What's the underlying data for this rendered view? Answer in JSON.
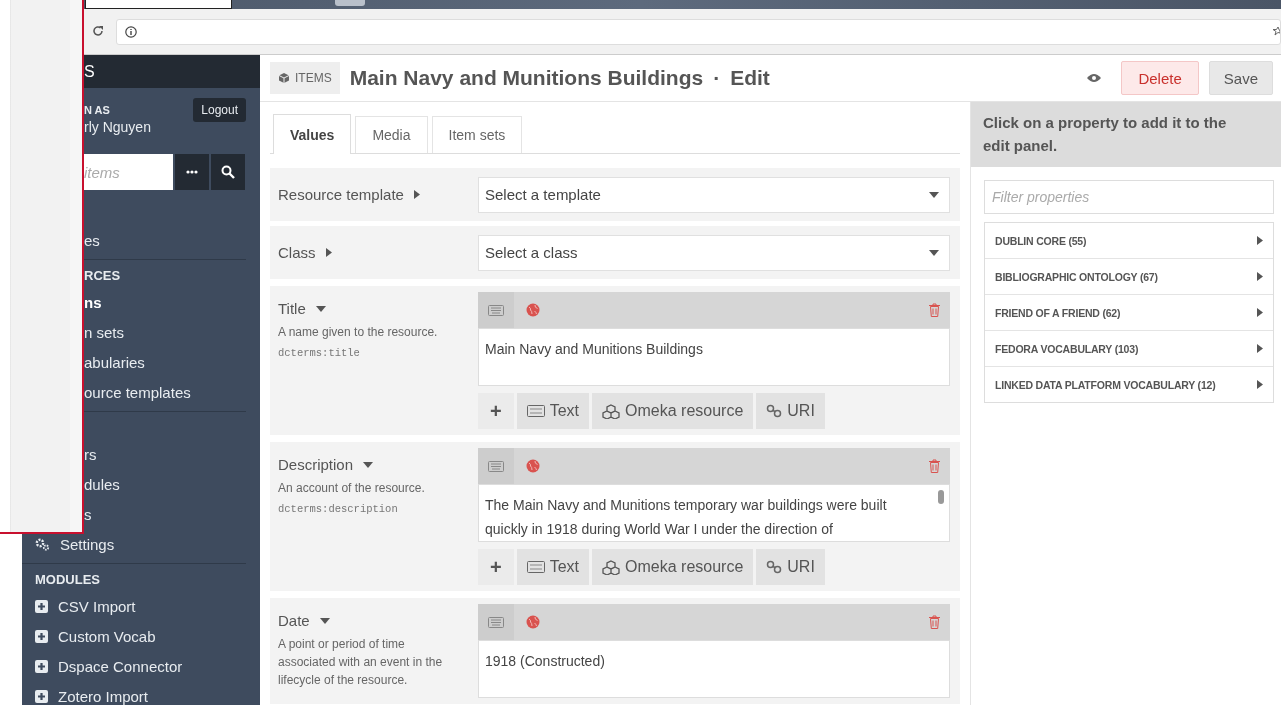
{
  "sidebar": {
    "brand": "S",
    "user_label": "N AS",
    "user_name": "rly Nguyen",
    "logout": "Logout",
    "search": {
      "placeholder": "items"
    },
    "sections": [
      {
        "items": [
          {
            "label": "es",
            "kind": "clipped",
            "selected": false
          }
        ]
      },
      {
        "heading": {
          "label": "RCES",
          "kind": "clipped"
        },
        "items": [
          {
            "label": "ns",
            "kind": "clipped",
            "selected": true
          },
          {
            "label": "n sets",
            "kind": "clipped",
            "selected": false
          },
          {
            "label": "abularies",
            "kind": "clipped",
            "selected": false
          },
          {
            "label": "ource templates",
            "kind": "clipped",
            "selected": false
          }
        ]
      },
      {
        "items": [
          {
            "label": "rs",
            "kind": "clipped",
            "selected": false
          },
          {
            "label": "dules",
            "kind": "clipped",
            "selected": false
          },
          {
            "label": "s",
            "kind": "clipped",
            "selected": false
          },
          {
            "label": "Settings",
            "kind": "settings",
            "selected": false
          }
        ]
      },
      {
        "heading": {
          "label": "MODULES",
          "kind": "plain"
        },
        "items": [
          {
            "label": "CSV Import",
            "kind": "module",
            "selected": false
          },
          {
            "label": "Custom Vocab",
            "kind": "module",
            "selected": false
          },
          {
            "label": "Dspace Connector",
            "kind": "module",
            "selected": false
          },
          {
            "label": "Zotero Import",
            "kind": "module",
            "selected": false
          }
        ]
      }
    ]
  },
  "header": {
    "badge": "ITEMS",
    "title": "Main Navy and Munitions Buildings",
    "separator": "·",
    "mode": "Edit",
    "delete": "Delete",
    "save": "Save"
  },
  "tabs": [
    {
      "label": "Values",
      "selected": true
    },
    {
      "label": "Media",
      "selected": false
    },
    {
      "label": "Item sets",
      "selected": false
    }
  ],
  "selects": [
    {
      "label": "Resource template",
      "value": "Select a template"
    },
    {
      "label": "Class",
      "value": "Select a class"
    }
  ],
  "properties": [
    {
      "label": "Title",
      "description": "A name given to the resource.",
      "term": "dcterms:title",
      "value": "Main Navy and Munitions Buildings",
      "scrollbar": false,
      "buttons": [
        {
          "kind": "add",
          "label": "+"
        },
        {
          "kind": "text",
          "label": "Text"
        },
        {
          "kind": "resource",
          "label": "Omeka resource"
        },
        {
          "kind": "uri",
          "label": "URI"
        }
      ]
    },
    {
      "label": "Description",
      "description": "An account of the resource.",
      "term": "dcterms:description",
      "value": "The Main Navy and Munitions temporary war buildings were built quickly in 1918 during World War I under the direction of",
      "scrollbar": true,
      "buttons": [
        {
          "kind": "add",
          "label": "+"
        },
        {
          "kind": "text",
          "label": "Text"
        },
        {
          "kind": "resource",
          "label": "Omeka resource"
        },
        {
          "kind": "uri",
          "label": "URI"
        }
      ]
    },
    {
      "label": "Date",
      "description": "A point or period of time associated with an event in the lifecycle of the resource.",
      "value": "1918 (Constructed)",
      "scrollbar": false
    }
  ],
  "property_panel": {
    "prompt": "Click on a property to add it to the edit panel.",
    "filter": {
      "placeholder": "Filter properties"
    },
    "vocabularies": [
      {
        "label": "DUBLIN CORE (55)",
        "expanded": false
      },
      {
        "label": "BIBLIOGRAPHIC ONTOLOGY (67)",
        "expanded": false
      },
      {
        "label": "FRIEND OF A FRIEND (62)",
        "expanded": false
      },
      {
        "label": "FEDORA VOCABULARY (103)",
        "expanded": false
      },
      {
        "label": "LINKED DATA PLATFORM VOCABULARY (12)",
        "expanded": false
      }
    ]
  }
}
